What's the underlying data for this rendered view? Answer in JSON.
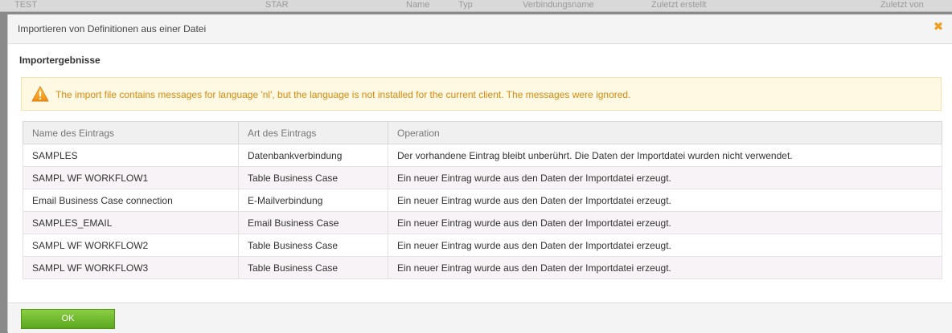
{
  "background": {
    "header_cells": [
      "TEST",
      "STAR",
      "Name",
      "Typ",
      "Verbindungsname",
      "Zuletzt erstellt",
      "Zuletzt von"
    ]
  },
  "dialog": {
    "title": "Importieren von Definitionen aus einer Datei",
    "close_icon": "close-icon",
    "section_title": "Importergebnisse",
    "warning": {
      "icon": "warning-icon",
      "text": "The import file contains messages for language 'nl', but the language is not installed for the current client. The messages were ignored."
    },
    "table": {
      "columns": [
        "Name des Eintrags",
        "Art des Eintrags",
        "Operation"
      ],
      "rows": [
        [
          "SAMPLES",
          "Datenbankverbindung",
          "Der vorhandene Eintrag bleibt unberührt. Die Daten der Importdatei wurden nicht verwendet."
        ],
        [
          "SAMPL WF WORKFLOW1",
          "Table Business Case",
          "Ein neuer Eintrag wurde aus den Daten der Importdatei erzeugt."
        ],
        [
          "Email Business Case connection",
          "E-Mailverbindung",
          "Ein neuer Eintrag wurde aus den Daten der Importdatei erzeugt."
        ],
        [
          "SAMPLES_EMAIL",
          "Email Business Case",
          "Ein neuer Eintrag wurde aus den Daten der Importdatei erzeugt."
        ],
        [
          "SAMPL WF WORKFLOW2",
          "Table Business Case",
          "Ein neuer Eintrag wurde aus den Daten der Importdatei erzeugt."
        ],
        [
          "SAMPL WF WORKFLOW3",
          "Table Business Case",
          "Ein neuer Eintrag wurde aus den Daten der Importdatei erzeugt."
        ]
      ]
    },
    "ok_label": "OK"
  },
  "colors": {
    "accent_green": "#6bb82c",
    "warning_text": "#d88a10",
    "close_icon": "#f0a020"
  }
}
